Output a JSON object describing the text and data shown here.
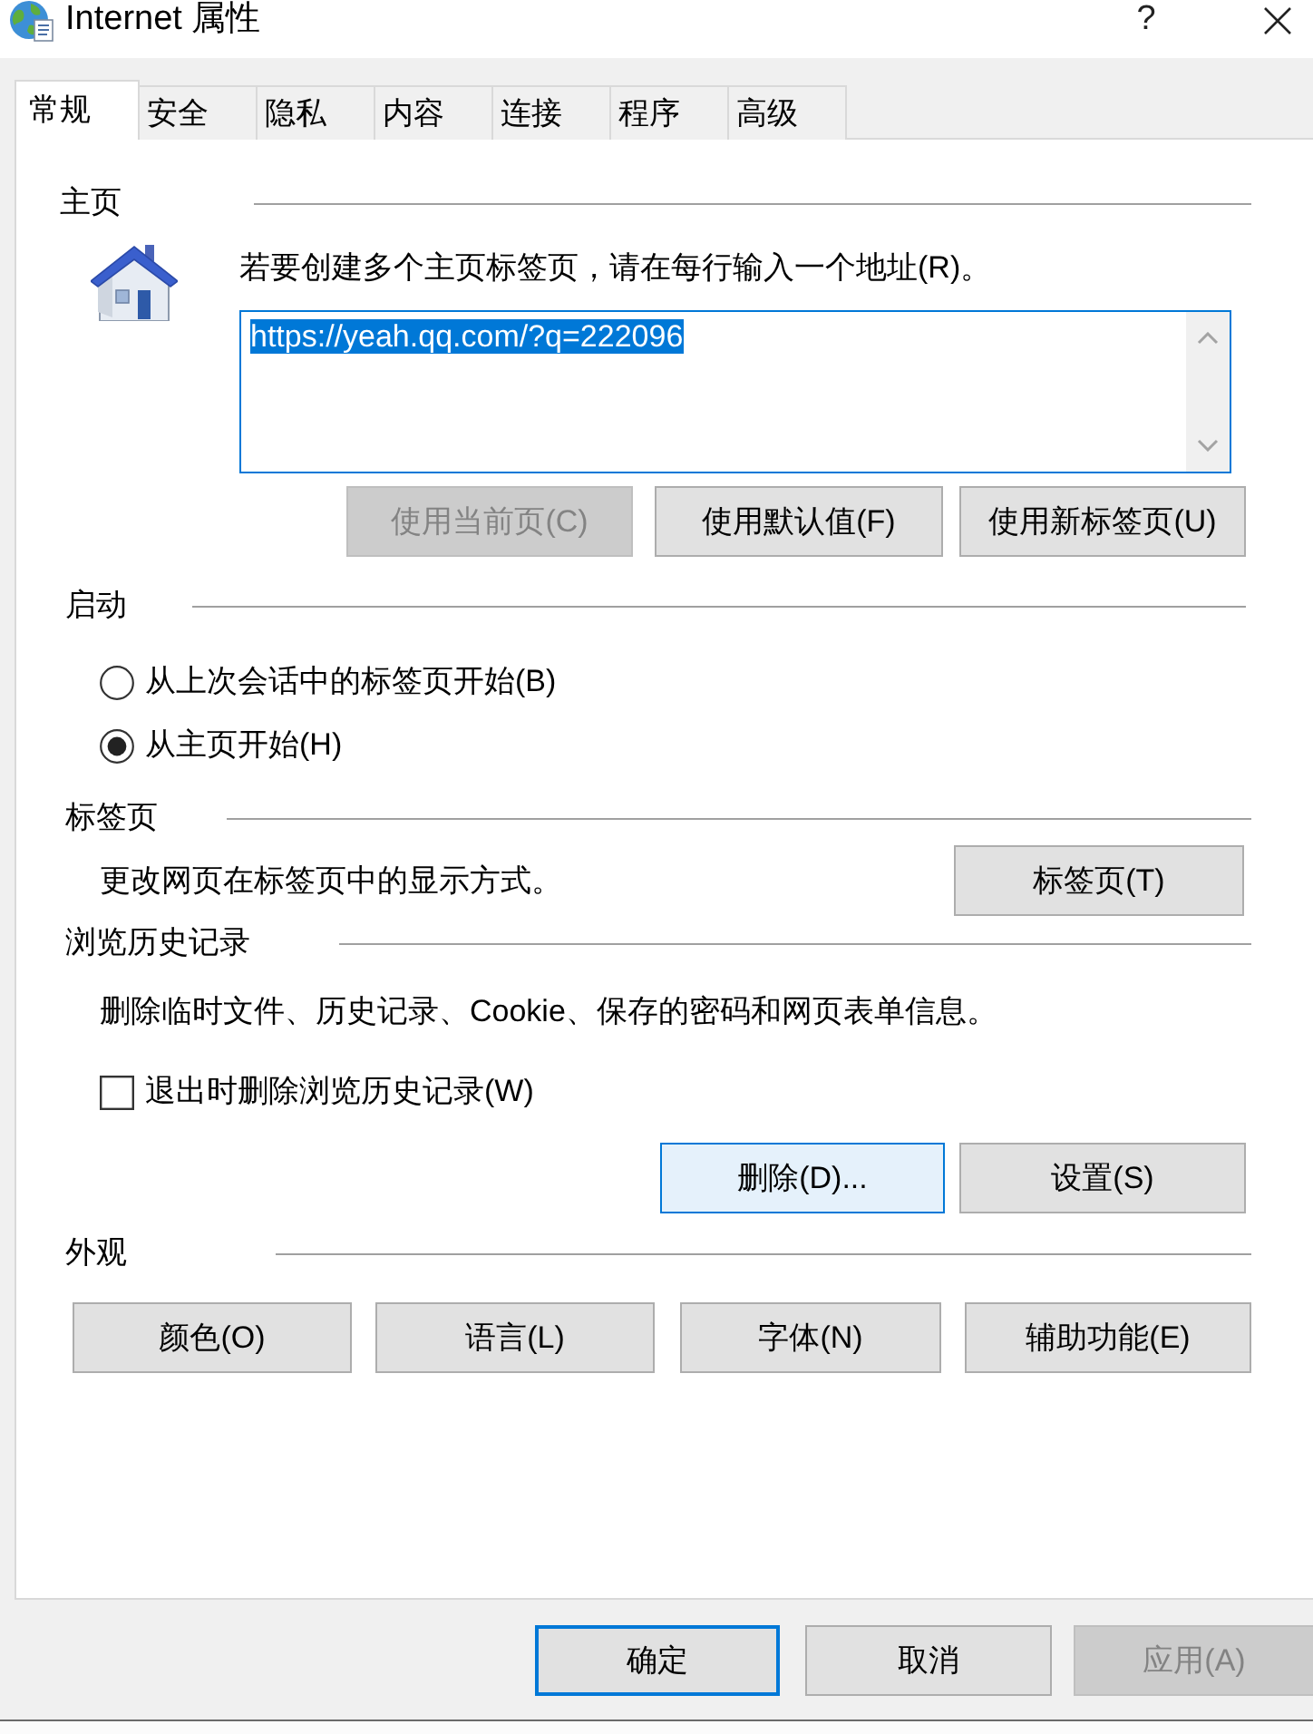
{
  "window": {
    "title": "Internet 属性",
    "help_button": "?"
  },
  "tabs": [
    {
      "label": "常规",
      "selected": true
    },
    {
      "label": "安全",
      "selected": false
    },
    {
      "label": "隐私",
      "selected": false
    },
    {
      "label": "内容",
      "selected": false
    },
    {
      "label": "连接",
      "selected": false
    },
    {
      "label": "程序",
      "selected": false
    },
    {
      "label": "高级",
      "selected": false
    }
  ],
  "home_page": {
    "heading": "主页",
    "instruction": "若要创建多个主页标签页，请在每行输入一个地址(R)。",
    "addresses": {
      "value": "https://yeah.qq.com/?q=222096",
      "selected": true
    },
    "buttons": [
      {
        "label": "使用当前页(C)",
        "disabled": true
      },
      {
        "label": "使用默认值(F)",
        "disabled": false
      },
      {
        "label": "使用新标签页(U)",
        "disabled": false
      }
    ]
  },
  "startup": {
    "heading": "启动",
    "options": [
      {
        "label": "从上次会话中的标签页开始(B)",
        "selected": false
      },
      {
        "label": "从主页开始(H)",
        "selected": true
      }
    ]
  },
  "tabs_group": {
    "heading": "标签页",
    "description": "更改网页在标签页中的显示方式。",
    "button": "标签页(T)"
  },
  "browsing_history": {
    "heading": "浏览历史记录",
    "description": "删除临时文件、历史记录、Cookie、保存的密码和网页表单信息。",
    "delete_on_exit": {
      "label": "退出时删除浏览历史记录(W)",
      "checked": false
    },
    "buttons": [
      {
        "label": "删除(D)...",
        "hovered": true
      },
      {
        "label": "设置(S)",
        "hovered": false
      }
    ]
  },
  "appearance": {
    "heading": "外观",
    "buttons": [
      "颜色(O)",
      "语言(L)",
      "字体(N)",
      "辅助功能(E)"
    ]
  },
  "dialog_buttons": [
    {
      "label": "确定",
      "default": true,
      "disabled": false
    },
    {
      "label": "取消",
      "default": false,
      "disabled": false
    },
    {
      "label": "应用(A)",
      "default": false,
      "disabled": true
    }
  ]
}
